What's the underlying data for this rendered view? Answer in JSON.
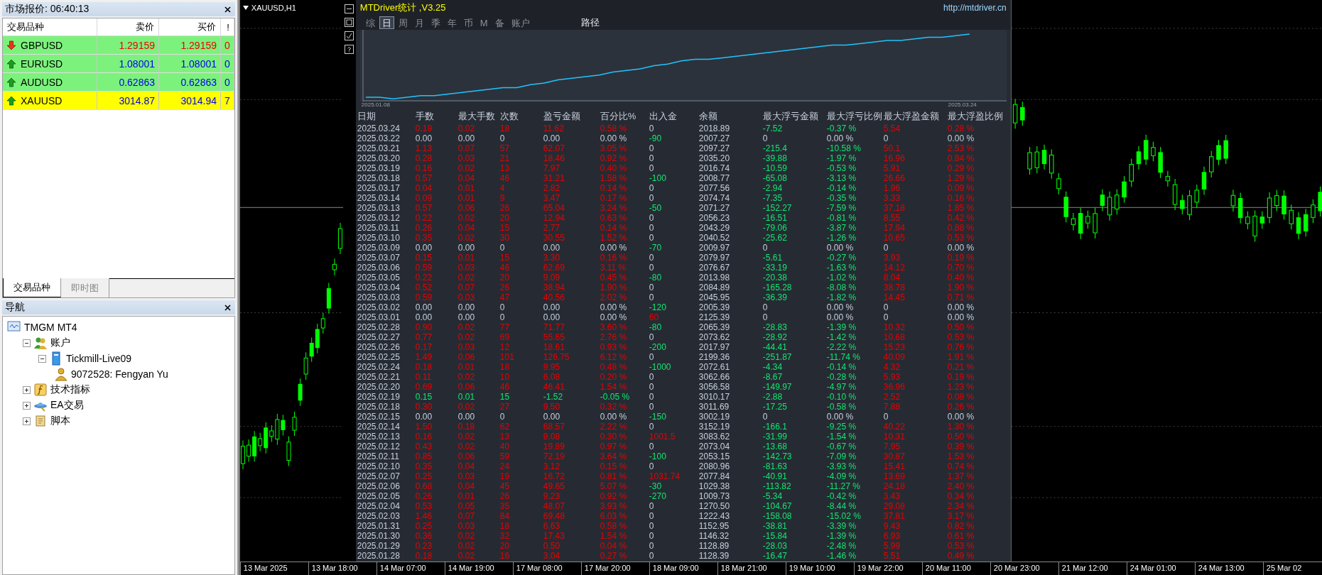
{
  "market_watch": {
    "title": "市场报价: 06:40:13",
    "columns": [
      "交易品种",
      "卖价",
      "买价",
      "!"
    ],
    "rows": [
      {
        "symbol": "GBPUSD",
        "bid": "1.29159",
        "ask": "1.29159",
        "spread": "0",
        "falling": true,
        "selected": false
      },
      {
        "symbol": "EURUSD",
        "bid": "1.08001",
        "ask": "1.08001",
        "spread": "0",
        "falling": false,
        "selected": false
      },
      {
        "symbol": "AUDUSD",
        "bid": "0.62863",
        "ask": "0.62863",
        "spread": "0",
        "falling": false,
        "selected": false
      },
      {
        "symbol": "XAUUSD",
        "bid": "3014.87",
        "ask": "3014.94",
        "spread": "7",
        "falling": false,
        "selected": true
      }
    ],
    "tabs": [
      {
        "label": "交易品种",
        "selected": true
      },
      {
        "label": "即时图",
        "selected": false
      }
    ]
  },
  "navigator": {
    "title": "导航",
    "tree": [
      {
        "label": "TMGM MT4",
        "kind": "terminal",
        "children": [
          {
            "label": "账户",
            "kind": "accounts",
            "expanded": true,
            "children": [
              {
                "label": "Tickmill-Live09",
                "kind": "server",
                "expanded": true,
                "children": [
                  {
                    "label": "9072528: Fengyan Yu",
                    "kind": "account"
                  }
                ]
              }
            ]
          },
          {
            "label": "技术指标",
            "kind": "indicators",
            "expanded": false
          },
          {
            "label": "EA交易",
            "kind": "experts",
            "expanded": false
          },
          {
            "label": "脚本",
            "kind": "scripts",
            "expanded": false
          }
        ]
      }
    ]
  },
  "chart": {
    "symbol": "XAUUSD,H1",
    "time_axis": [
      "13 Mar 2025",
      "13 Mar 18:00",
      "14 Mar 07:00",
      "14 Mar 19:00",
      "17 Mar 08:00",
      "17 Mar 20:00",
      "18 Mar 09:00",
      "18 Mar 21:00",
      "19 Mar 10:00",
      "19 Mar 22:00",
      "20 Mar 11:00",
      "20 Mar 23:00",
      "21 Mar 12:00",
      "24 Mar 01:00",
      "24 Mar 13:00",
      "25 Mar 02"
    ]
  },
  "stats_panel": {
    "title": "MTDriver统计 ,V3.25",
    "link": "http://mtdriver.cn",
    "tabs": [
      {
        "label": "综",
        "selected": false
      },
      {
        "label": "日",
        "selected": true
      },
      {
        "label": "周",
        "selected": false
      },
      {
        "label": "月",
        "selected": false
      },
      {
        "label": "季",
        "selected": false
      },
      {
        "label": "年",
        "selected": false
      },
      {
        "label": "币",
        "selected": false
      },
      {
        "label": "M",
        "selected": false
      },
      {
        "label": "备",
        "selected": false
      },
      {
        "label": "账户",
        "selected": false
      }
    ],
    "path_button": "路径",
    "equity_curve": {
      "start_label": "2025.01.08",
      "end_label": "2025.03.24"
    },
    "columns": [
      "日期",
      "手数",
      "最大手数",
      "次数",
      "盈亏金额",
      "百分比%",
      "出入金",
      "余额",
      "最大浮亏金额",
      "最大浮亏比例",
      "最大浮盈金额",
      "最大浮盈比例"
    ],
    "rows": [
      {
        "cells": [
          "2025.03.24",
          "0.19",
          "0.02",
          "18",
          "11.62",
          "0.58 %",
          "0",
          "2018.89",
          "-7.52",
          "-0.37 %",
          "5.54",
          "0.28 %"
        ],
        "traded": true,
        "loss": false,
        "deposit": false,
        "withdrawal": false
      },
      {
        "cells": [
          "2025.03.22",
          "0.00",
          "0.00",
          "0",
          "0.00",
          "0.00 %",
          "-90",
          "2007.27",
          "0",
          "0.00 %",
          "0",
          "0.00 %"
        ],
        "traded": false,
        "loss": false,
        "deposit": false,
        "withdrawal": true
      },
      {
        "cells": [
          "2025.03.21",
          "1.13",
          "0.07",
          "57",
          "62.07",
          "3.05 %",
          "0",
          "2097.27",
          "-215.4",
          "-10.58 %",
          "50.1",
          "2.53 %"
        ],
        "traded": true,
        "loss": false,
        "deposit": false,
        "withdrawal": false
      },
      {
        "cells": [
          "2025.03.20",
          "0.28",
          "0.03",
          "21",
          "18.46",
          "0.92 %",
          "0",
          "2035.20",
          "-39.88",
          "-1.97 %",
          "16.96",
          "0.84 %"
        ],
        "traded": true,
        "loss": false,
        "deposit": false,
        "withdrawal": false
      },
      {
        "cells": [
          "2025.03.19",
          "0.16",
          "0.02",
          "13",
          "7.97",
          "0.40 %",
          "0",
          "2016.74",
          "-10.59",
          "-0.53 %",
          "5.91",
          "0.29 %"
        ],
        "traded": true,
        "loss": false,
        "deposit": false,
        "withdrawal": false
      },
      {
        "cells": [
          "2025.03.18",
          "0.57",
          "0.04",
          "46",
          "31.21",
          "1.58 %",
          "-100",
          "2008.77",
          "-65.08",
          "-3.13 %",
          "26.66",
          "1.29 %"
        ],
        "traded": true,
        "loss": false,
        "deposit": false,
        "withdrawal": true
      },
      {
        "cells": [
          "2025.03.17",
          "0.04",
          "0.01",
          "4",
          "2.82",
          "0.14 %",
          "0",
          "2077.56",
          "-2.94",
          "-0.14 %",
          "1.96",
          "0.09 %"
        ],
        "traded": true,
        "loss": false,
        "deposit": false,
        "withdrawal": false
      },
      {
        "cells": [
          "2025.03.14",
          "0.09",
          "0.01",
          "9",
          "3.47",
          "0.17 %",
          "0",
          "2074.74",
          "-7.35",
          "-0.35 %",
          "3.33",
          "0.16 %"
        ],
        "traded": true,
        "loss": false,
        "deposit": false,
        "withdrawal": false
      },
      {
        "cells": [
          "2025.03.13",
          "0.57",
          "0.06",
          "26",
          "65.04",
          "3.24 %",
          "-50",
          "2071.27",
          "-152.27",
          "-7.59 %",
          "37.18",
          "1.85 %"
        ],
        "traded": true,
        "loss": false,
        "deposit": false,
        "withdrawal": true
      },
      {
        "cells": [
          "2025.03.12",
          "0.22",
          "0.02",
          "20",
          "12.94",
          "0.63 %",
          "0",
          "2056.23",
          "-16.51",
          "-0.81 %",
          "8.55",
          "0.42 %"
        ],
        "traded": true,
        "loss": false,
        "deposit": false,
        "withdrawal": false
      },
      {
        "cells": [
          "2025.03.11",
          "0.26",
          "0.04",
          "15",
          "2.77",
          "0.14 %",
          "0",
          "2043.29",
          "-79.06",
          "-3.87 %",
          "17.94",
          "0.88 %"
        ],
        "traded": true,
        "loss": false,
        "deposit": false,
        "withdrawal": false
      },
      {
        "cells": [
          "2025.03.10",
          "0.35",
          "0.02",
          "30",
          "30.55",
          "1.52 %",
          "0",
          "2040.52",
          "-25.62",
          "-1.26 %",
          "10.65",
          "0.53 %"
        ],
        "traded": true,
        "loss": false,
        "deposit": false,
        "withdrawal": false
      },
      {
        "cells": [
          "2025.03.09",
          "0.00",
          "0.00",
          "0",
          "0.00",
          "0.00 %",
          "-70",
          "2009.97",
          "0",
          "0.00 %",
          "0",
          "0.00 %"
        ],
        "traded": false,
        "loss": false,
        "deposit": false,
        "withdrawal": true
      },
      {
        "cells": [
          "2025.03.07",
          "0.15",
          "0.01",
          "15",
          "3.30",
          "0.16 %",
          "0",
          "2079.97",
          "-5.61",
          "-0.27 %",
          "3.93",
          "0.19 %"
        ],
        "traded": true,
        "loss": false,
        "deposit": false,
        "withdrawal": false
      },
      {
        "cells": [
          "2025.03.06",
          "0.59",
          "0.03",
          "46",
          "62.69",
          "3.11 %",
          "0",
          "2076.67",
          "-33.19",
          "-1.63 %",
          "14.12",
          "0.70 %"
        ],
        "traded": true,
        "loss": false,
        "deposit": false,
        "withdrawal": false
      },
      {
        "cells": [
          "2025.03.05",
          "0.22",
          "0.02",
          "20",
          "9.09",
          "0.45 %",
          "-80",
          "2013.98",
          "-20.38",
          "-1.02 %",
          "8.04",
          "0.40 %"
        ],
        "traded": true,
        "loss": false,
        "deposit": false,
        "withdrawal": true
      },
      {
        "cells": [
          "2025.03.04",
          "0.52",
          "0.07",
          "26",
          "38.94",
          "1.90 %",
          "0",
          "2084.89",
          "-165.28",
          "-8.08 %",
          "38.78",
          "1.90 %"
        ],
        "traded": true,
        "loss": false,
        "deposit": false,
        "withdrawal": false
      },
      {
        "cells": [
          "2025.03.03",
          "0.59",
          "0.03",
          "47",
          "40.56",
          "2.02 %",
          "0",
          "2045.95",
          "-36.39",
          "-1.82 %",
          "14.45",
          "0.71 %"
        ],
        "traded": true,
        "loss": false,
        "deposit": false,
        "withdrawal": false
      },
      {
        "cells": [
          "2025.03.02",
          "0.00",
          "0.00",
          "0",
          "0.00",
          "0.00 %",
          "-120",
          "2005.39",
          "0",
          "0.00 %",
          "0",
          "0.00 %"
        ],
        "traded": false,
        "loss": false,
        "deposit": false,
        "withdrawal": true
      },
      {
        "cells": [
          "2025.03.01",
          "0.00",
          "0.00",
          "0",
          "0.00",
          "0.00 %",
          "60",
          "2125.39",
          "0",
          "0.00 %",
          "0",
          "0.00 %"
        ],
        "traded": false,
        "loss": false,
        "deposit": true,
        "withdrawal": false
      },
      {
        "cells": [
          "2025.02.28",
          "0.90",
          "0.02",
          "77",
          "71.77",
          "3.60 %",
          "-80",
          "2065.39",
          "-28.83",
          "-1.39 %",
          "10.32",
          "0.50 %"
        ],
        "traded": true,
        "loss": false,
        "deposit": false,
        "withdrawal": true
      },
      {
        "cells": [
          "2025.02.27",
          "0.77",
          "0.02",
          "69",
          "55.65",
          "2.76 %",
          "0",
          "2073.62",
          "-28.92",
          "-1.42 %",
          "10.68",
          "0.53 %"
        ],
        "traded": true,
        "loss": false,
        "deposit": false,
        "withdrawal": false
      },
      {
        "cells": [
          "2025.02.26",
          "0.17",
          "0.03",
          "12",
          "18.61",
          "0.93 %",
          "-200",
          "2017.97",
          "-44.41",
          "-2.22 %",
          "15.23",
          "0.76 %"
        ],
        "traded": true,
        "loss": false,
        "deposit": false,
        "withdrawal": true
      },
      {
        "cells": [
          "2025.02.25",
          "1.49",
          "0.06",
          "101",
          "126.75",
          "6.12 %",
          "0",
          "2199.36",
          "-251.87",
          "-11.74 %",
          "40.09",
          "1.91 %"
        ],
        "traded": true,
        "loss": false,
        "deposit": false,
        "withdrawal": false
      },
      {
        "cells": [
          "2025.02.24",
          "0.18",
          "0.01",
          "18",
          "9.95",
          "0.48 %",
          "-1000",
          "2072.61",
          "-4.34",
          "-0.14 %",
          "4.32",
          "0.21 %"
        ],
        "traded": true,
        "loss": false,
        "deposit": false,
        "withdrawal": true
      },
      {
        "cells": [
          "2025.02.21",
          "0.11",
          "0.02",
          "10",
          "6.08",
          "0.20 %",
          "0",
          "3062.66",
          "-8.67",
          "-0.28 %",
          "5.93",
          "0.19 %"
        ],
        "traded": true,
        "loss": false,
        "deposit": false,
        "withdrawal": false
      },
      {
        "cells": [
          "2025.02.20",
          "0.69",
          "0.06",
          "46",
          "46.41",
          "1.54 %",
          "0",
          "3056.58",
          "-149.97",
          "-4.97 %",
          "36.96",
          "1.23 %"
        ],
        "traded": true,
        "loss": false,
        "deposit": false,
        "withdrawal": false
      },
      {
        "cells": [
          "2025.02.19",
          "0.15",
          "0.01",
          "15",
          "-1.52",
          "-0.05 %",
          "0",
          "3010.17",
          "-2.88",
          "-0.10 %",
          "2.52",
          "0.08 %"
        ],
        "traded": true,
        "loss": true,
        "deposit": false,
        "withdrawal": false
      },
      {
        "cells": [
          "2025.02.18",
          "0.30",
          "0.02",
          "27",
          "9.50",
          "0.32 %",
          "0",
          "3011.69",
          "-17.25",
          "-0.58 %",
          "7.88",
          "0.26 %"
        ],
        "traded": true,
        "loss": false,
        "deposit": false,
        "withdrawal": false
      },
      {
        "cells": [
          "2025.02.15",
          "0.00",
          "0.00",
          "0",
          "0.00",
          "0.00 %",
          "-150",
          "3002.19",
          "0",
          "0.00 %",
          "0",
          "0.00 %"
        ],
        "traded": false,
        "loss": false,
        "deposit": false,
        "withdrawal": true
      },
      {
        "cells": [
          "2025.02.14",
          "1.50",
          "0.18",
          "62",
          "68.57",
          "2.22 %",
          "0",
          "3152.19",
          "-166.1",
          "-9.25 %",
          "40.22",
          "1.30 %"
        ],
        "traded": true,
        "loss": false,
        "deposit": false,
        "withdrawal": false
      },
      {
        "cells": [
          "2025.02.13",
          "0.16",
          "0.02",
          "13",
          "9.08",
          "0.30 %",
          "1001.5",
          "3083.62",
          "-31.99",
          "-1.54 %",
          "10.31",
          "0.50 %"
        ],
        "traded": true,
        "loss": false,
        "deposit": true,
        "withdrawal": false
      },
      {
        "cells": [
          "2025.02.12",
          "0.43",
          "0.02",
          "40",
          "19.89",
          "0.97 %",
          "0",
          "2073.04",
          "-13.68",
          "-0.67 %",
          "7.95",
          "0.39 %"
        ],
        "traded": true,
        "loss": false,
        "deposit": false,
        "withdrawal": false
      },
      {
        "cells": [
          "2025.02.11",
          "0.85",
          "0.06",
          "59",
          "72.19",
          "3.64 %",
          "-100",
          "2053.15",
          "-142.73",
          "-7.09 %",
          "30.87",
          "1.53 %"
        ],
        "traded": true,
        "loss": false,
        "deposit": false,
        "withdrawal": true
      },
      {
        "cells": [
          "2025.02.10",
          "0.35",
          "0.04",
          "24",
          "3.12",
          "0.15 %",
          "0",
          "2080.96",
          "-81.63",
          "-3.93 %",
          "15.41",
          "0.74 %"
        ],
        "traded": true,
        "loss": false,
        "deposit": false,
        "withdrawal": false
      },
      {
        "cells": [
          "2025.02.07",
          "0.25",
          "0.03",
          "19",
          "16.72",
          "0.81 %",
          "1031.74",
          "2077.84",
          "-40.91",
          "-4.09 %",
          "13.69",
          "1.37 %"
        ],
        "traded": true,
        "loss": false,
        "deposit": true,
        "withdrawal": false
      },
      {
        "cells": [
          "2025.02.06",
          "0.68",
          "0.04",
          "45",
          "49.65",
          "5.07 %",
          "-30",
          "1029.38",
          "-113.82",
          "-11.27 %",
          "24.18",
          "2.40 %"
        ],
        "traded": true,
        "loss": false,
        "deposit": false,
        "withdrawal": true
      },
      {
        "cells": [
          "2025.02.05",
          "0.26",
          "0.01",
          "26",
          "9.23",
          "0.92 %",
          "-270",
          "1009.73",
          "-5.34",
          "-0.42 %",
          "3.43",
          "0.34 %"
        ],
        "traded": true,
        "loss": false,
        "deposit": false,
        "withdrawal": true
      },
      {
        "cells": [
          "2025.02.04",
          "0.53",
          "0.05",
          "35",
          "48.07",
          "3.93 %",
          "0",
          "1270.50",
          "-104.67",
          "-8.44 %",
          "29.08",
          "2.34 %"
        ],
        "traded": true,
        "loss": false,
        "deposit": false,
        "withdrawal": false
      },
      {
        "cells": [
          "2025.02.03",
          "1.46",
          "0.07",
          "84",
          "69.48",
          "6.03 %",
          "0",
          "1222.43",
          "-158.08",
          "-15.02 %",
          "37.81",
          "3.17 %"
        ],
        "traded": true,
        "loss": false,
        "deposit": false,
        "withdrawal": false
      },
      {
        "cells": [
          "2025.01.31",
          "0.25",
          "0.03",
          "18",
          "6.63",
          "0.58 %",
          "0",
          "1152.95",
          "-38.81",
          "-3.39 %",
          "9.43",
          "0.82 %"
        ],
        "traded": true,
        "loss": false,
        "deposit": false,
        "withdrawal": false
      },
      {
        "cells": [
          "2025.01.30",
          "0.36",
          "0.02",
          "32",
          "17.43",
          "1.54 %",
          "0",
          "1146.32",
          "-15.84",
          "-1.39 %",
          "6.93",
          "0.61 %"
        ],
        "traded": true,
        "loss": false,
        "deposit": false,
        "withdrawal": false
      },
      {
        "cells": [
          "2025.01.29",
          "0.23",
          "0.02",
          "20",
          "0.50",
          "0.04 %",
          "0",
          "1128.89",
          "-28.03",
          "-2.48 %",
          "5.99",
          "0.53 %"
        ],
        "traded": true,
        "loss": false,
        "deposit": false,
        "withdrawal": false
      },
      {
        "cells": [
          "2025.01.28",
          "0.18",
          "0.02",
          "16",
          "3.04",
          "0.27 %",
          "0",
          "1128.39",
          "-16.47",
          "-1.46 %",
          "5.51",
          "0.49 %"
        ],
        "traded": true,
        "loss": false,
        "deposit": false,
        "withdrawal": false
      }
    ]
  }
}
